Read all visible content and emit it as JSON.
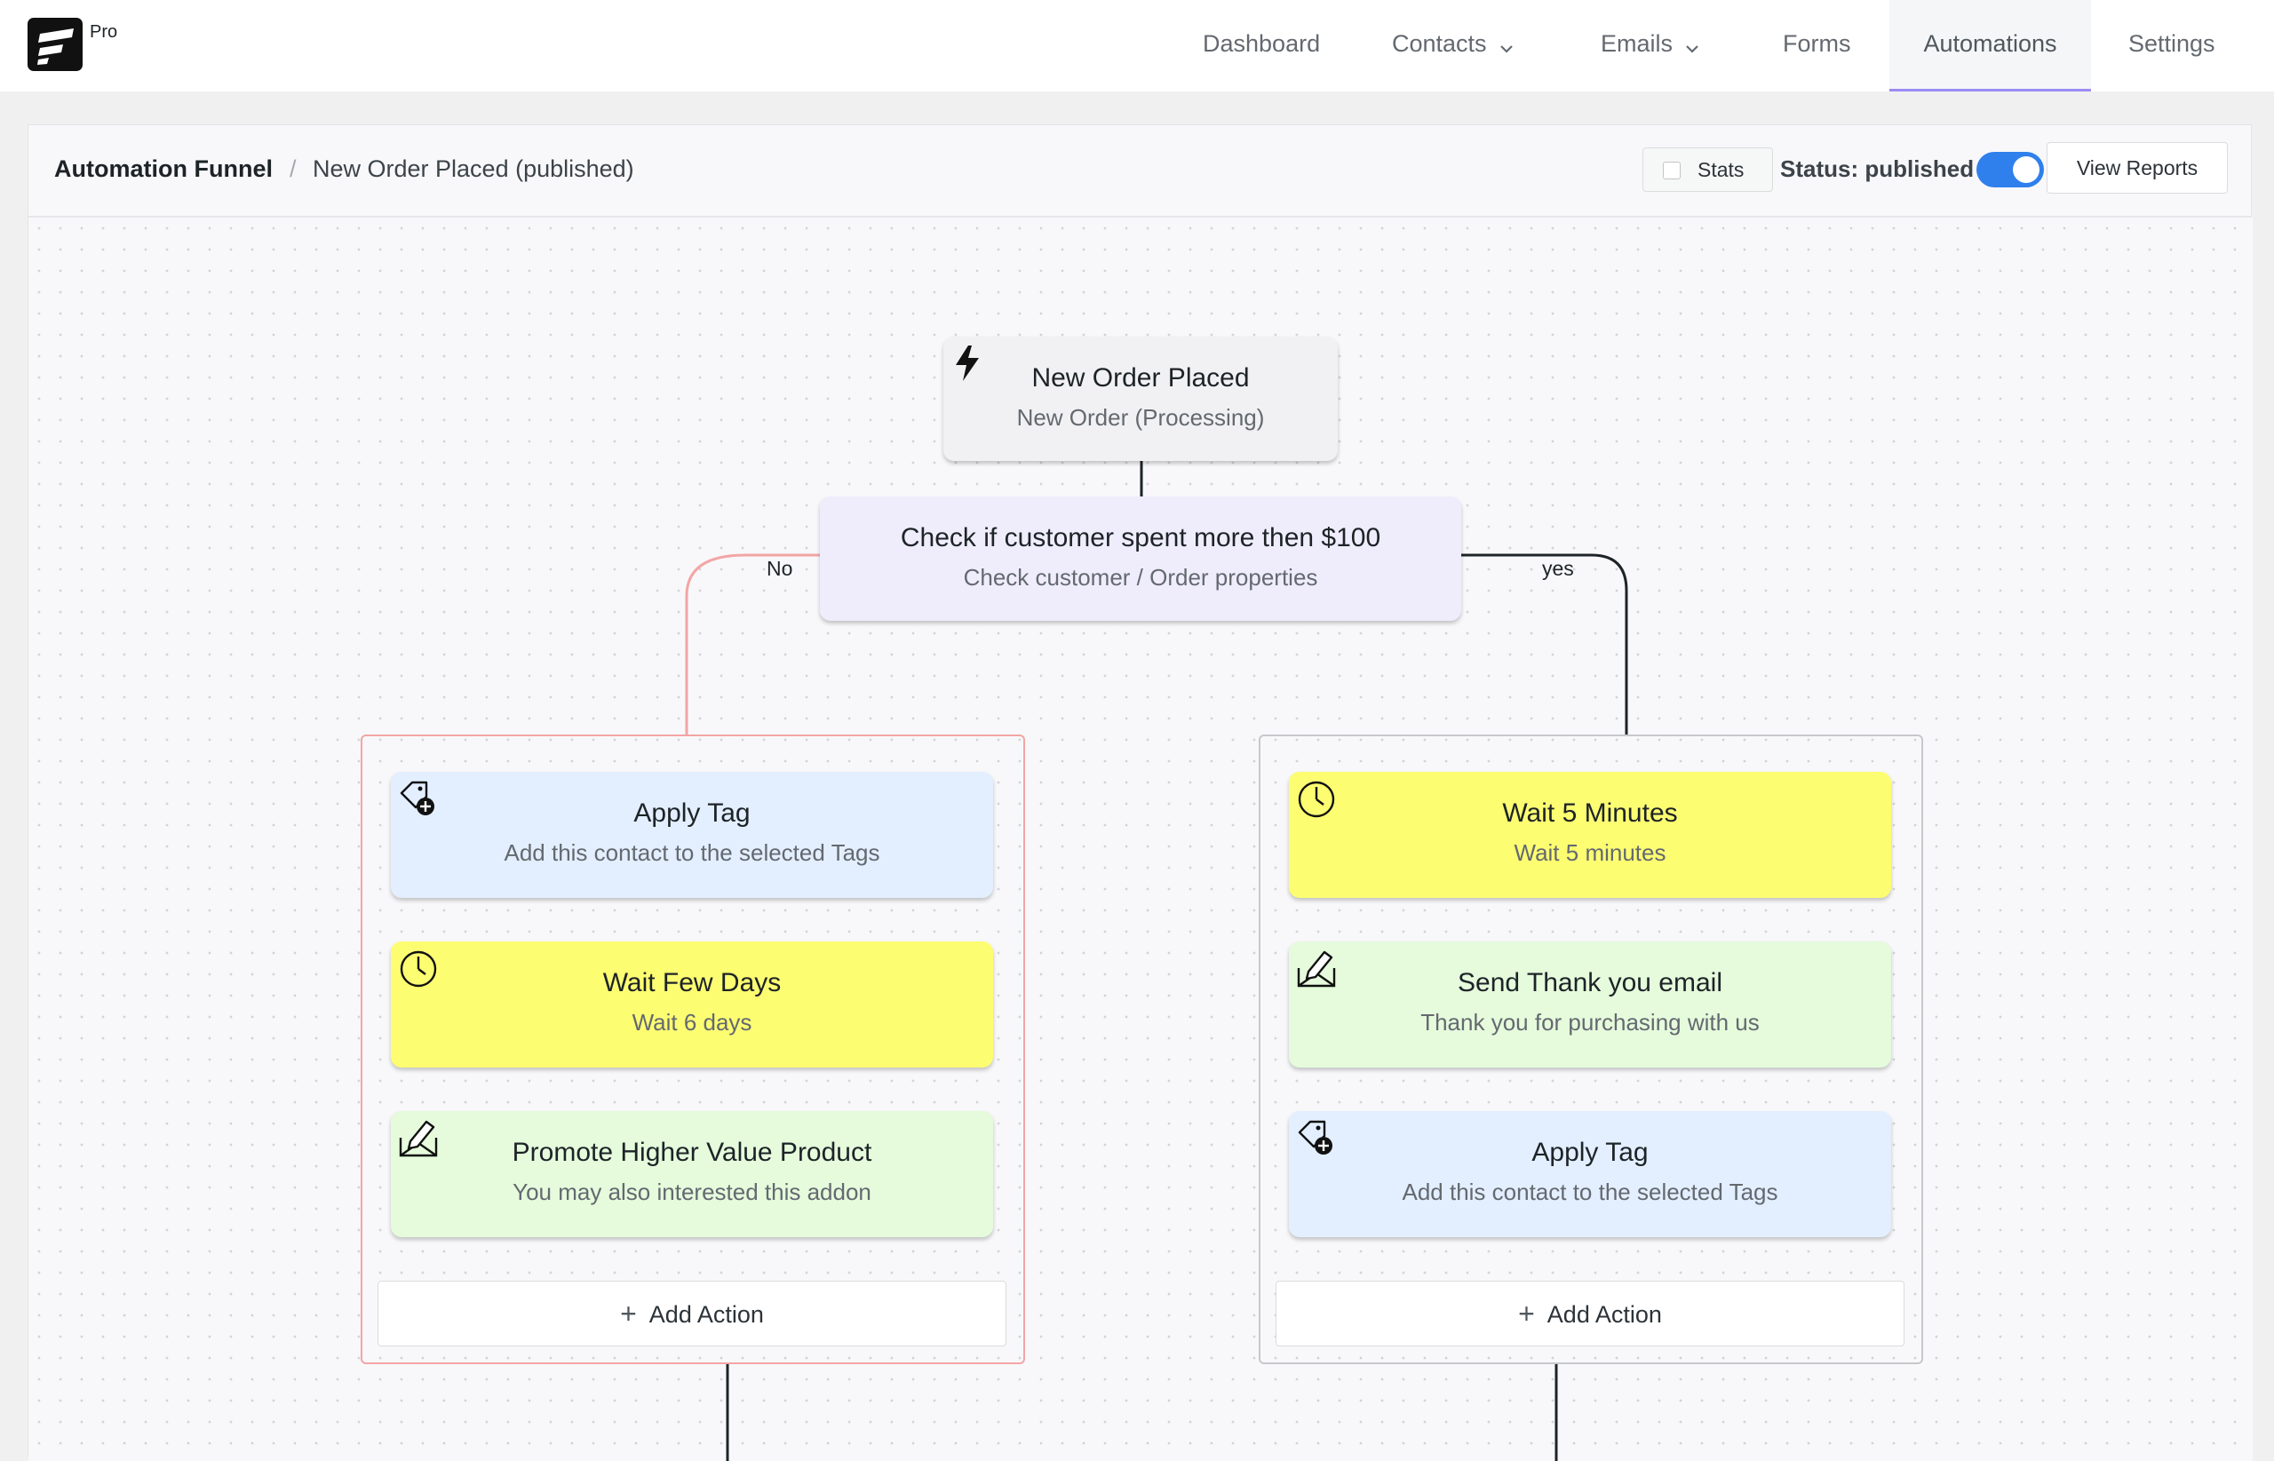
{
  "brand": {
    "badge": "Pro"
  },
  "nav": {
    "items": [
      {
        "label": "Dashboard"
      },
      {
        "label": "Contacts"
      },
      {
        "label": "Emails"
      },
      {
        "label": "Forms"
      },
      {
        "label": "Automations"
      },
      {
        "label": "Settings"
      }
    ],
    "active": "Automations"
  },
  "header": {
    "breadcrumb_root": "Automation Funnel",
    "breadcrumb_sep": "/",
    "breadcrumb_current": "New Order Placed (published)",
    "stats_label": "Stats",
    "status_label": "Status: published",
    "status_on": true,
    "view_reports_label": "View Reports"
  },
  "funnel": {
    "trigger": {
      "title": "New Order Placed",
      "subtitle": "New Order (Processing)",
      "icon": "lightning-icon"
    },
    "condition": {
      "title": "Check if customer spent more then $100",
      "subtitle": "Check customer / Order properties"
    },
    "branches": {
      "no": {
        "label": "No",
        "color": "#f3a5a5",
        "actions": [
          {
            "title": "Apply Tag",
            "subtitle": "Add this contact to the selected Tags",
            "icon": "tag-add-icon",
            "color": "#e3efff"
          },
          {
            "title": "Wait Few Days",
            "subtitle": "Wait 6 days",
            "icon": "clock-icon",
            "color": "#fdfd72"
          },
          {
            "title": "Promote Higher Value Product",
            "subtitle": "You may also interested this addon",
            "icon": "email-edit-icon",
            "color": "#e5fbdc"
          }
        ],
        "add_action_label": "Add Action"
      },
      "yes": {
        "label": "yes",
        "color": "#1d2327",
        "actions": [
          {
            "title": "Wait 5 Minutes",
            "subtitle": "Wait 5 minutes",
            "icon": "clock-icon",
            "color": "#fdfd72"
          },
          {
            "title": "Send Thank you email",
            "subtitle": "Thank you for purchasing with us",
            "icon": "email-edit-icon",
            "color": "#e5fbdc"
          },
          {
            "title": "Apply Tag",
            "subtitle": "Add this contact to the selected Tags",
            "icon": "tag-add-icon",
            "color": "#e3efff"
          }
        ],
        "add_action_label": "Add Action"
      }
    }
  }
}
